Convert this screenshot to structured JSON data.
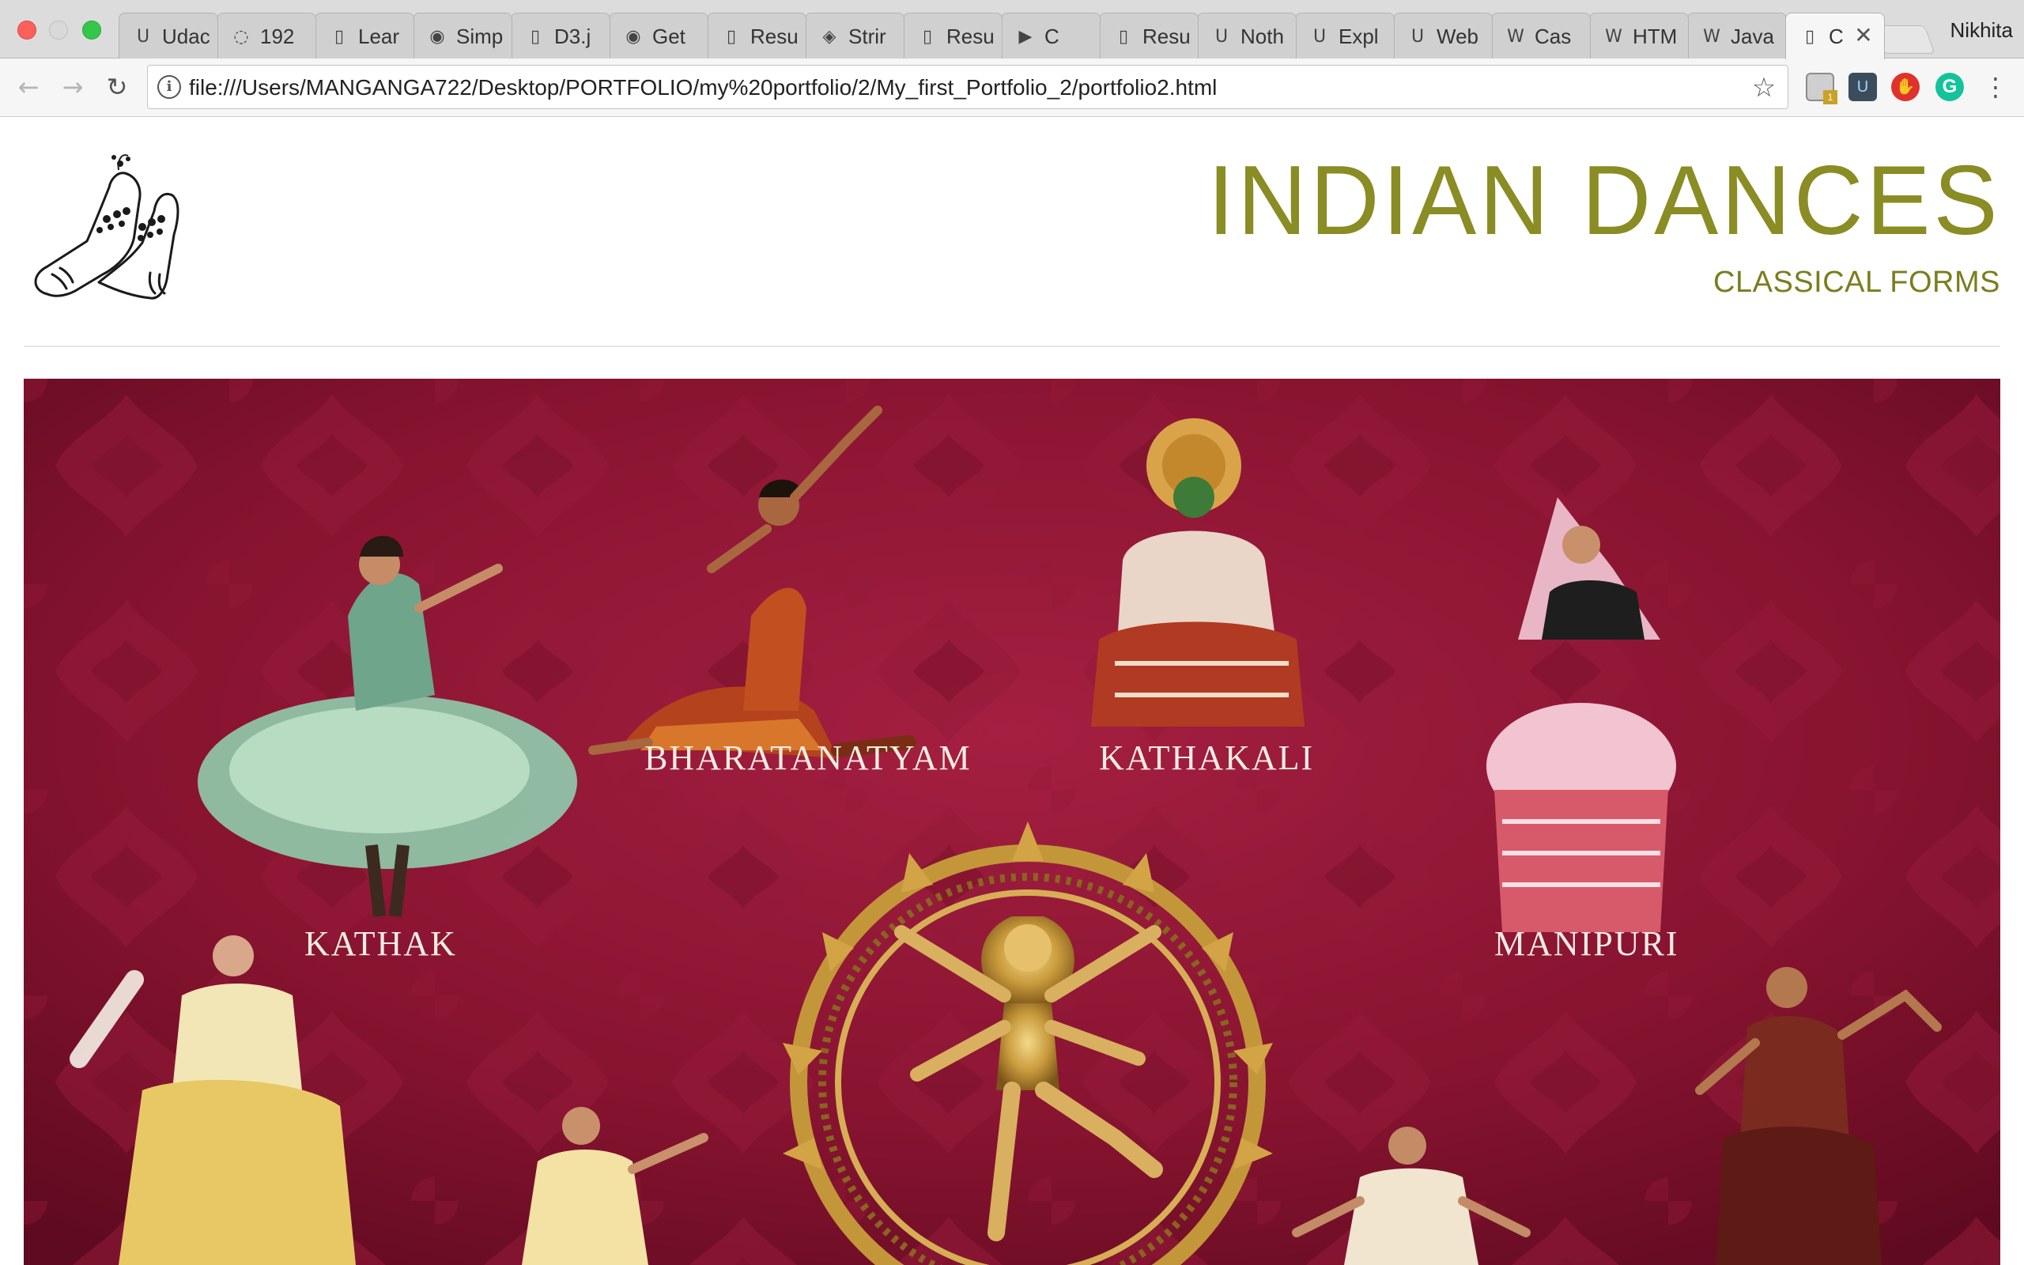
{
  "browser": {
    "tabs": [
      {
        "icon": "udacity-icon",
        "glyph": "U",
        "title": "Udacity"
      },
      {
        "icon": "loading-icon",
        "glyph": "◌",
        "title": "192"
      },
      {
        "icon": "document-icon",
        "glyph": "▯",
        "title": "Lear"
      },
      {
        "icon": "google-icon",
        "glyph": "◉",
        "title": "Simp"
      },
      {
        "icon": "document-icon",
        "glyph": "▯",
        "title": "D3.j"
      },
      {
        "icon": "google-icon",
        "glyph": "◉",
        "title": "Get"
      },
      {
        "icon": "document-icon",
        "glyph": "▯",
        "title": "Resu"
      },
      {
        "icon": "bookmark-icon",
        "glyph": "◈",
        "title": "Strir"
      },
      {
        "icon": "document-icon",
        "glyph": "▯",
        "title": "Resu"
      },
      {
        "icon": "youtube-icon",
        "glyph": "▶",
        "title": "C"
      },
      {
        "icon": "document-icon",
        "glyph": "▯",
        "title": "Resu"
      },
      {
        "icon": "udacity-icon",
        "glyph": "U",
        "title": "Noth"
      },
      {
        "icon": "udacity-icon",
        "glyph": "U",
        "title": "Expl"
      },
      {
        "icon": "udacity-icon",
        "glyph": "U",
        "title": "Web"
      },
      {
        "icon": "wikipedia-icon",
        "glyph": "W",
        "title": "Cas"
      },
      {
        "icon": "wikipedia-icon",
        "glyph": "W",
        "title": "HTM"
      },
      {
        "icon": "wikipedia-icon",
        "glyph": "W",
        "title": "Java"
      },
      {
        "icon": "document-icon",
        "glyph": "▯",
        "title": "C",
        "active": true
      }
    ],
    "profile_name": "Nikhita",
    "url": "file:///Users/MANGANGA722/Desktop/PORTFOLIO/my%20portfolio/2/My_first_Portfolio_2/portfolio2.html"
  },
  "page": {
    "title": "INDIAN DANCES",
    "subtitle": "CLASSICAL FORMS",
    "hero": {
      "labels": {
        "bharatanatyam": "BHARATANATYAM",
        "kathakali": "KATHAKALI",
        "kathak": "KATHAK",
        "manipuri": "MANIPURI"
      }
    }
  },
  "colors": {
    "title": "#8a8c24",
    "hero_background": "#82122f",
    "label_text": "#f4ece2"
  }
}
